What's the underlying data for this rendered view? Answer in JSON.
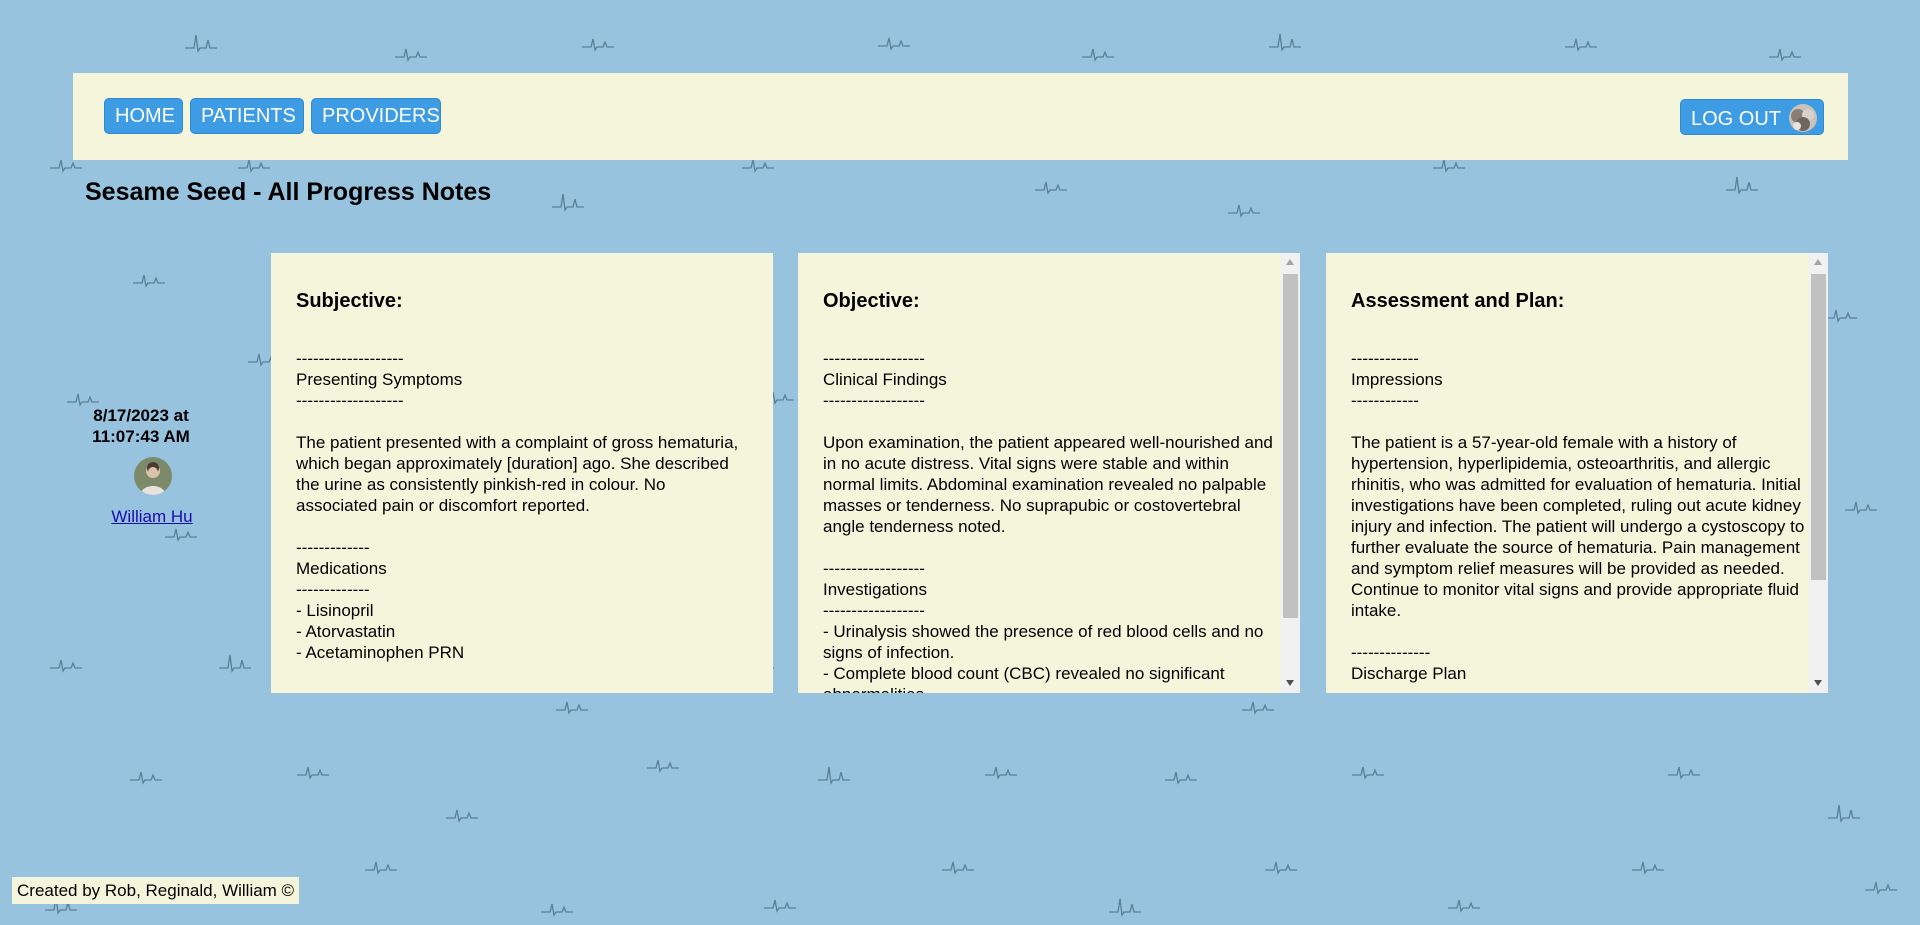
{
  "nav": {
    "home_label": "HOME",
    "patients_label": "PATIENTS",
    "providers_label": "PROVIDERS",
    "logout_label": "LOG OUT"
  },
  "page": {
    "title": "Sesame Seed - All Progress Notes"
  },
  "note": {
    "datetime": "8/17/2023 at 11:07:43 AM",
    "provider_name": "William Hu",
    "sections": [
      {
        "heading": "Subjective:",
        "body": "-------------------\nPresenting Symptoms\n-------------------\n\nThe patient presented with a complaint of gross hematuria, which began approximately [duration] ago. She described the urine as consistently pinkish-red in colour. No associated pain or discomfort reported.\n\n-------------\nMedications\n-------------\n- Lisinopril\n- Atorvastatin\n- Acetaminophen PRN"
      },
      {
        "heading": "Objective:",
        "body": "------------------\nClinical Findings\n------------------\n\nUpon examination, the patient appeared well-nourished and in no acute distress. Vital signs were stable and within normal limits. Abdominal examination revealed no palpable masses or tenderness. No suprapubic or costovertebral angle tenderness noted.\n\n------------------\nInvestigations\n------------------\n- Urinalysis showed the presence of red blood cells and no signs of infection.\n- Complete blood count (CBC) revealed no significant abnormalities."
      },
      {
        "heading": "Assessment and Plan:",
        "body": "------------\nImpressions\n------------\n\nThe patient is a 57-year-old female with a history of hypertension, hyperlipidemia, osteoarthritis, and allergic rhinitis, who was admitted for evaluation of hematuria. Initial investigations have been completed, ruling out acute kidney injury and infection. The patient will undergo a cystoscopy to further evaluate the source of hematuria. Pain management and symptom relief measures will be provided as needed. Continue to monitor vital signs and provide appropriate fluid intake.\n\n--------------\nDischarge Plan"
      }
    ]
  },
  "footer": {
    "credit": "Created by Rob, Reginald, William ©"
  },
  "colors": {
    "background": "#97c3df",
    "panel": "#f5f5dc",
    "button": "#3d9ce3",
    "link": "#1a0dab"
  }
}
